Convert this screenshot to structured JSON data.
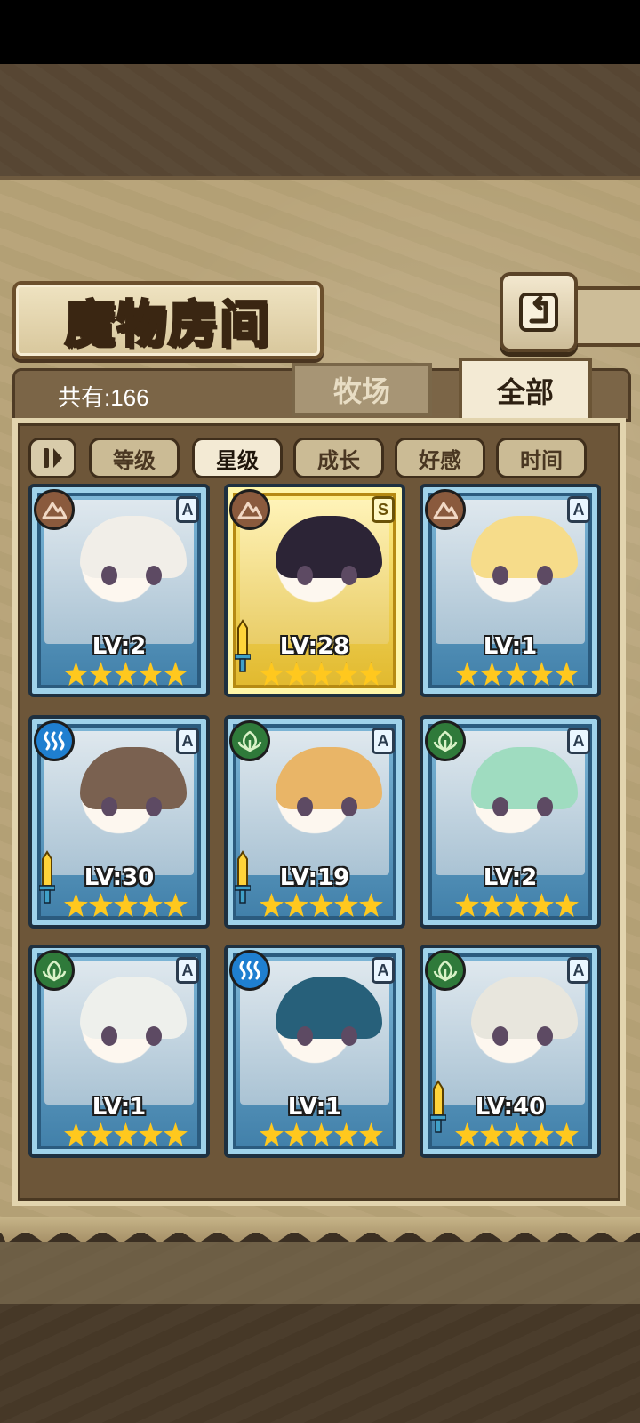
{
  "header": {
    "title": "魔物房间",
    "count_label": "共有:166",
    "tabs": [
      {
        "label": "牧场",
        "active": false
      },
      {
        "label": "全部",
        "active": true
      }
    ]
  },
  "sort": {
    "buttons": [
      {
        "label": "等级",
        "active": false
      },
      {
        "label": "星级",
        "active": true
      },
      {
        "label": "成长",
        "active": false
      },
      {
        "label": "好感",
        "active": false
      },
      {
        "label": "时间",
        "active": false
      }
    ]
  },
  "monsters": [
    {
      "level": "LV:2",
      "element": "earth-icon",
      "rank": "A",
      "stars": 5,
      "frame": "blue",
      "equipped_sword": false
    },
    {
      "level": "LV:28",
      "element": "earth-icon",
      "rank": "S",
      "stars": 5,
      "frame": "gold",
      "equipped_sword": true
    },
    {
      "level": "LV:1",
      "element": "earth-icon",
      "rank": "A",
      "stars": 5,
      "frame": "blue",
      "equipped_sword": false
    },
    {
      "level": "LV:30",
      "element": "water-icon",
      "rank": "A",
      "stars": 5,
      "frame": "blue",
      "equipped_sword": true
    },
    {
      "level": "LV:19",
      "element": "leaf-icon",
      "rank": "A",
      "stars": 5,
      "frame": "blue",
      "equipped_sword": true
    },
    {
      "level": "LV:2",
      "element": "leaf-icon",
      "rank": "A",
      "stars": 5,
      "frame": "blue",
      "equipped_sword": false
    },
    {
      "level": "LV:1",
      "element": "leaf-icon",
      "rank": "A",
      "stars": 5,
      "frame": "blue",
      "equipped_sword": false
    },
    {
      "level": "LV:1",
      "element": "water-icon",
      "rank": "A",
      "stars": 5,
      "frame": "blue",
      "equipped_sword": false
    },
    {
      "level": "LV:40",
      "element": "leaf-icon",
      "rank": "A",
      "stars": 5,
      "frame": "blue",
      "equipped_sword": true
    }
  ],
  "colors": {
    "earth": "#8a5a3d",
    "water": "#1f7fd0",
    "leaf": "#2f7a3a",
    "star": "#ffc81e"
  }
}
